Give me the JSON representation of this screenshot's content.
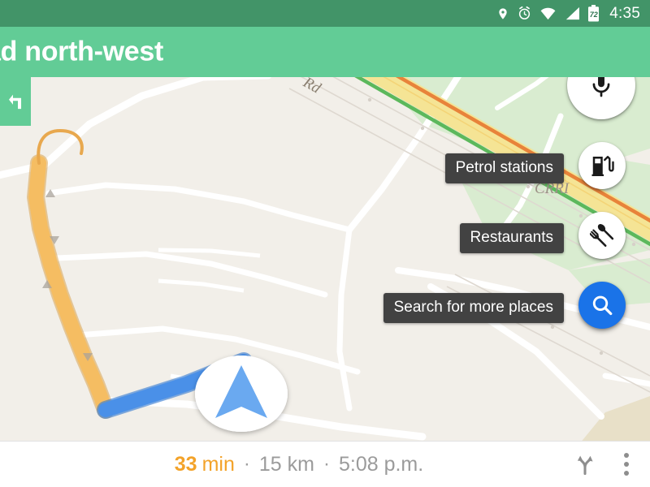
{
  "statusbar": {
    "time": "4:35",
    "battery_level": "72",
    "icons": [
      "location-pin-icon",
      "alarm-clock-icon",
      "wifi-icon",
      "cellular-signal-icon",
      "battery-icon"
    ],
    "background_color": "#429468"
  },
  "nav_header": {
    "instruction": "ad north-west",
    "maneuver_icon": "turn-left-arrow-icon",
    "background_color": "#62cc96",
    "text_color": "#ffffff"
  },
  "map": {
    "labels": [
      {
        "text": "CRRI",
        "kind": "area-label"
      },
      {
        "text": "Rd",
        "kind": "road-label"
      }
    ],
    "route": {
      "remaining_color": "#f5bd62",
      "traveled_color": "#4a90e8",
      "position_marker_icon": "navigation-chevron-icon"
    },
    "colors": {
      "land": "#f2efe9",
      "road_white": "#ffffff",
      "park_green": "#d9ecd0",
      "highway_yellow": "#f7e9a0",
      "traffic_orange": "#e8833a",
      "traffic_green": "#5cb85c",
      "building_beige": "#e8e0c8"
    }
  },
  "fabs": [
    {
      "name": "voice-search",
      "icon": "microphone-icon",
      "label": null,
      "style": "white"
    },
    {
      "name": "petrol-stations",
      "icon": "fuel-pump-icon",
      "label": "Petrol stations",
      "style": "white"
    },
    {
      "name": "restaurants",
      "icon": "restaurant-icon",
      "label": "Restaurants",
      "style": "white"
    },
    {
      "name": "search-more",
      "icon": "magnifier-icon",
      "label": "Search for more places",
      "style": "blue",
      "color": "#1a73e8"
    }
  ],
  "bottom_bar": {
    "duration_value": "33",
    "duration_unit": "min",
    "separator": "·",
    "distance": "15 km",
    "arrival_time": "5:08 p.m.",
    "duration_color": "#f3a32a",
    "actions": [
      {
        "name": "route-overview-button",
        "icon": "route-fork-icon"
      },
      {
        "name": "more-options-button",
        "icon": "overflow-dots-icon"
      }
    ]
  }
}
